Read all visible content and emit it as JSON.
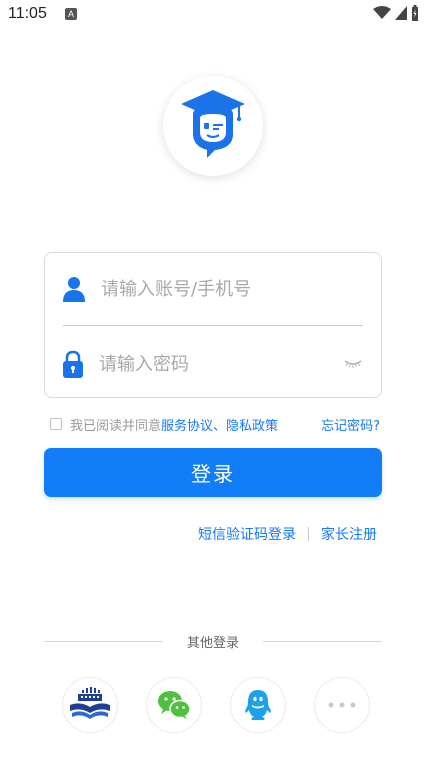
{
  "status_bar": {
    "time": "11:05",
    "badge": "A"
  },
  "logo": {
    "icon": "graduation-cap-chat-icon",
    "color": "#1a73e8"
  },
  "login_form": {
    "account_placeholder": "请输入账号/手机号",
    "password_placeholder": "请输入密码"
  },
  "agreement": {
    "prefix": "我已阅读并同意",
    "service_link": "服务协议",
    "separator": "、",
    "privacy_link": "隐私政策",
    "forgot_link": "忘记密码?"
  },
  "login_button": {
    "label": "登录",
    "color": "#137df8"
  },
  "alt_logins": {
    "sms_label": "短信验证码登录",
    "parent_register": "家长注册"
  },
  "other_login": {
    "title": "其他登录",
    "options": [
      "school-book-icon",
      "wechat-icon",
      "qq-icon",
      "more-icon"
    ]
  },
  "colors": {
    "accent": "#1677ff",
    "brand": "#1a73e8"
  }
}
